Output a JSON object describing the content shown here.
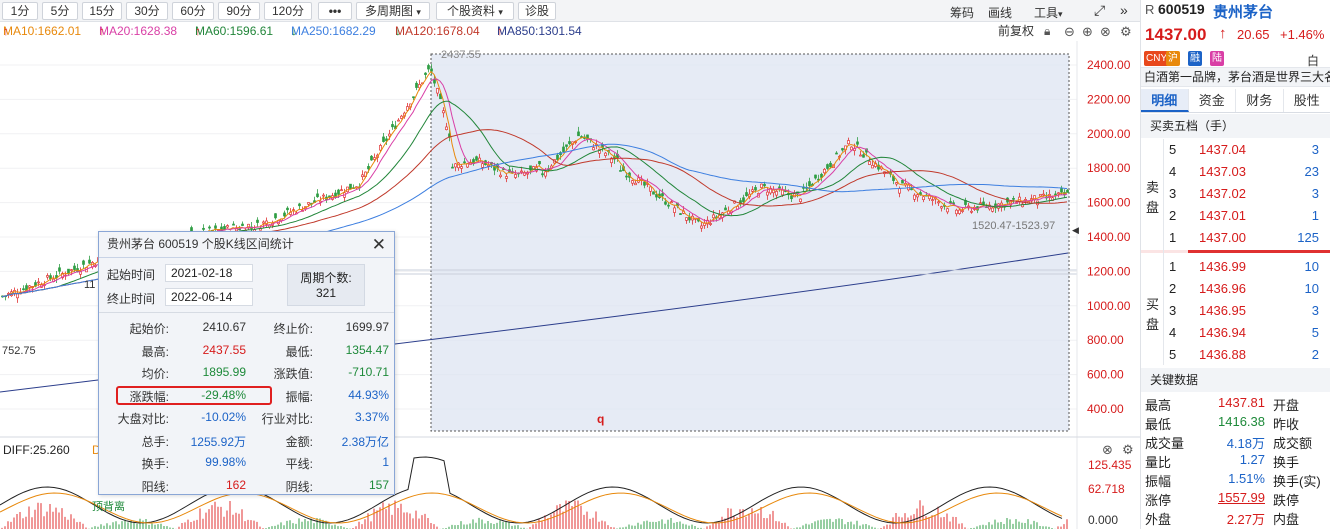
{
  "toolbar": {
    "periods": [
      "1分",
      "5分",
      "15分",
      "30分",
      "60分",
      "90分",
      "120分"
    ],
    "more": "•••",
    "multi_period": "多周期图",
    "stock_info": "个股资料",
    "diagnose": "诊股",
    "chips": "筹码",
    "draw": "画线",
    "tools": "工具"
  },
  "ma": {
    "ma10": "MA10:1662.01",
    "ma20": "MA20:1628.38",
    "ma60": "MA60:1596.61",
    "ma250": "MA250:1682.29",
    "ma120": "MA120:1678.04",
    "ma850": "MA850:1301.54",
    "forward_adj": "前复权",
    "colors": {
      "ma10": "#e8890c",
      "ma20": "#d93fa6",
      "ma60": "#22863a",
      "ma250": "#3d7fe0",
      "ma120": "#c0392b",
      "ma850": "#2c3e8c"
    }
  },
  "price_axis": [
    "2400.00",
    "2200.00",
    "2000.00",
    "1800.00",
    "1600.00",
    "1400.00",
    "1200.00",
    "1000.00",
    "800.00",
    "600.00",
    "400.00"
  ],
  "chart_labels": {
    "peak": "2437.55",
    "low_left": "752.75",
    "range_note": "1520.47-1523.97",
    "marker_q": "q",
    "partial_11": "11"
  },
  "macd": {
    "diff": "DIFF:25.260",
    "d_partial": "D",
    "axis": [
      "125.435",
      "62.718",
      "0.000"
    ],
    "watermark": "顶背离"
  },
  "popup": {
    "title": "贵州茅台  600519  个股K线区间统计",
    "start_label": "起始时间",
    "start": "2021-02-18",
    "end_label": "终止时间",
    "end": "2022-06-14",
    "count_label": "周期个数:",
    "count": "321",
    "rows": [
      {
        "l1": "起始价:",
        "v1": "2410.67",
        "c1": "dark",
        "l2": "终止价:",
        "v2": "1699.97",
        "c2": "dark"
      },
      {
        "l1": "最高:",
        "v1": "2437.55",
        "c1": "red",
        "l2": "最低:",
        "v2": "1354.47",
        "c2": "green"
      },
      {
        "l1": "均价:",
        "v1": "1895.99",
        "c1": "green",
        "l2": "涨跌值:",
        "v2": "-710.71",
        "c2": "green"
      },
      {
        "l1": "涨跌幅:",
        "v1": "-29.48%",
        "c1": "green",
        "l2": "振幅:",
        "v2": "44.93%",
        "c2": "blue"
      },
      {
        "l1": "大盘对比:",
        "v1": "-10.02%",
        "c1": "blue",
        "l2": "行业对比:",
        "v2": "3.37%",
        "c2": "blue"
      },
      {
        "l1": "总手:",
        "v1": "1255.92万",
        "c1": "blue",
        "l2": "金额:",
        "v2": "2.38万亿",
        "c2": "blue"
      },
      {
        "l1": "换手:",
        "v1": "99.98%",
        "c1": "blue",
        "l2": "平线:",
        "v2": "1",
        "c2": "blue"
      },
      {
        "l1": "阳线:",
        "v1": "162",
        "c1": "red",
        "l2": "阴线:",
        "v2": "157",
        "c2": "green"
      }
    ]
  },
  "stock": {
    "prefix": "R",
    "code": "600519",
    "name": "贵州茅台",
    "price": "1437.00",
    "arrow": "↑",
    "change": "20.65",
    "pct": "+1.46%",
    "tags": [
      "CNY",
      "沪",
      "融",
      "陆"
    ],
    "tag_colors": [
      "#e8481c",
      "#e8890c",
      "#1c63c7",
      "#d93fa6"
    ],
    "partial": "白酒",
    "desc": "白酒第一品牌，茅台酒是世界三大名",
    "tabs": [
      "明细",
      "资金",
      "财务",
      "股性"
    ]
  },
  "orderbook": {
    "title": "买卖五档（手）",
    "sell_label": [
      "卖",
      "盘"
    ],
    "buy_label": [
      "买",
      "盘"
    ],
    "sell": [
      {
        "lvl": "5",
        "price": "1437.04",
        "vol": "3"
      },
      {
        "lvl": "4",
        "price": "1437.03",
        "vol": "23"
      },
      {
        "lvl": "3",
        "price": "1437.02",
        "vol": "3"
      },
      {
        "lvl": "2",
        "price": "1437.01",
        "vol": "1"
      },
      {
        "lvl": "1",
        "price": "1437.00",
        "vol": "125"
      }
    ],
    "buy": [
      {
        "lvl": "1",
        "price": "1436.99",
        "vol": "10"
      },
      {
        "lvl": "2",
        "price": "1436.96",
        "vol": "10"
      },
      {
        "lvl": "3",
        "price": "1436.95",
        "vol": "3"
      },
      {
        "lvl": "4",
        "price": "1436.94",
        "vol": "5"
      },
      {
        "lvl": "5",
        "price": "1436.88",
        "vol": "2"
      }
    ]
  },
  "keydata": {
    "title": "关键数据",
    "rows": [
      {
        "l": "最高",
        "v": "1437.81",
        "c": "red",
        "r": "开盘"
      },
      {
        "l": "最低",
        "v": "1416.38",
        "c": "green",
        "r": "昨收"
      },
      {
        "l": "成交量",
        "v": "4.18万",
        "c": "blue",
        "r": "成交额"
      },
      {
        "l": "量比",
        "v": "1.27",
        "c": "blue",
        "r": "换手"
      },
      {
        "l": "振幅",
        "v": "1.51%",
        "c": "blue",
        "r": "换手(实)"
      },
      {
        "l": "涨停",
        "v": "1557.99",
        "c": "red",
        "r": "跌停"
      },
      {
        "l": "外盘",
        "v": "2.27万",
        "c": "red",
        "r": "内盘"
      }
    ]
  }
}
